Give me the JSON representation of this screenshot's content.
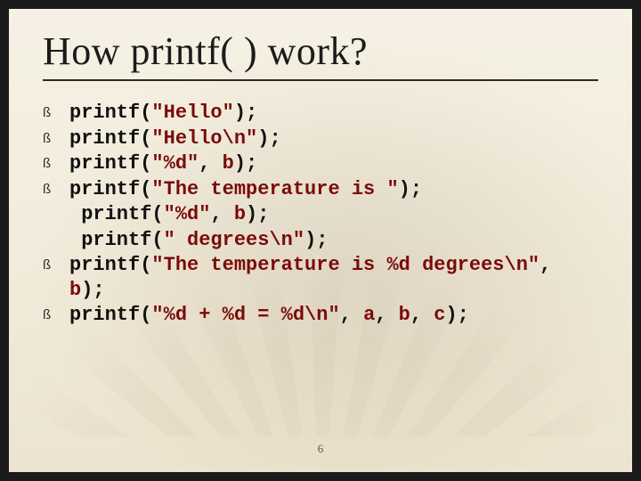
{
  "title": "How printf( ) work?",
  "bullet_glyph": "ß",
  "page_number": "6",
  "items": [
    {
      "bullet": true,
      "segments": [
        {
          "t": "printf("
        },
        {
          "t": "\"Hello\"",
          "c": "s"
        },
        {
          "t": ");"
        }
      ]
    },
    {
      "bullet": true,
      "segments": [
        {
          "t": "printf("
        },
        {
          "t": "\"Hello\\n\"",
          "c": "s"
        },
        {
          "t": ");"
        }
      ]
    },
    {
      "bullet": true,
      "segments": [
        {
          "t": "printf("
        },
        {
          "t": "\"%d\"",
          "c": "s"
        },
        {
          "t": ", "
        },
        {
          "t": "b",
          "c": "v"
        },
        {
          "t": ");"
        }
      ]
    },
    {
      "bullet": true,
      "segments": [
        {
          "t": "printf("
        },
        {
          "t": "\"The temperature is \"",
          "c": "s"
        },
        {
          "t": ");"
        }
      ]
    },
    {
      "bullet": false,
      "segments": [
        {
          "t": " printf("
        },
        {
          "t": "\"%d\"",
          "c": "s"
        },
        {
          "t": ", "
        },
        {
          "t": "b",
          "c": "v"
        },
        {
          "t": ");"
        }
      ]
    },
    {
      "bullet": false,
      "segments": [
        {
          "t": " printf("
        },
        {
          "t": "\" degrees\\n\"",
          "c": "s"
        },
        {
          "t": ");"
        }
      ]
    },
    {
      "bullet": true,
      "segments": [
        {
          "t": "printf("
        },
        {
          "t": "\"The temperature is %d degrees\\n\"",
          "c": "s"
        },
        {
          "t": ", "
        },
        {
          "t": "b",
          "c": "v"
        },
        {
          "t": ");"
        }
      ]
    },
    {
      "bullet": true,
      "segments": [
        {
          "t": "printf("
        },
        {
          "t": "\"%d + %d = %d\\n\"",
          "c": "s"
        },
        {
          "t": ", "
        },
        {
          "t": "a",
          "c": "v"
        },
        {
          "t": ", "
        },
        {
          "t": "b",
          "c": "v"
        },
        {
          "t": ", "
        },
        {
          "t": "c",
          "c": "v"
        },
        {
          "t": ");"
        }
      ]
    }
  ]
}
